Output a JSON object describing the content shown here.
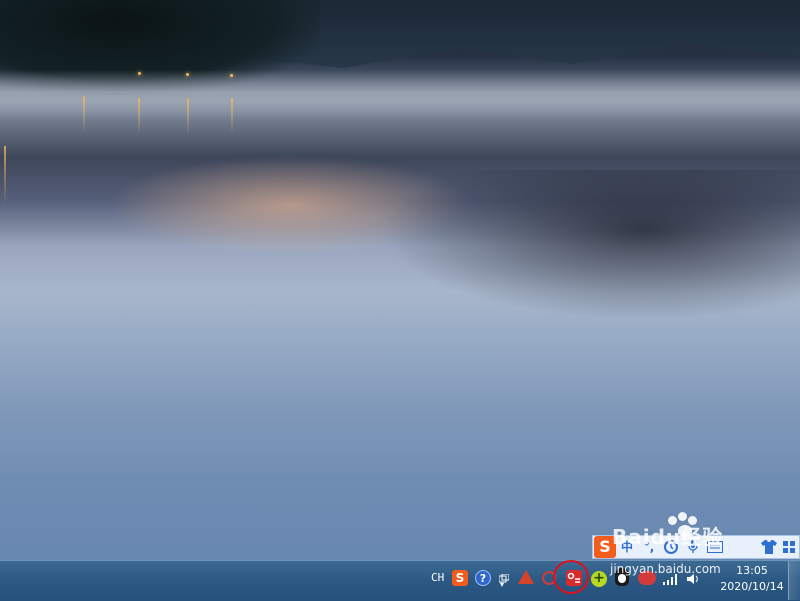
{
  "taskbar": {
    "language_indicator": "CH",
    "clock": {
      "time": "13:05",
      "date": "2020/10/14"
    },
    "tray_icons": [
      "sogou-input-icon",
      "help-icon",
      "network-icon",
      "show-hidden-icons-arrow",
      "red-triangle-app-icon",
      "red-circle-app-icon",
      "red-app-icon",
      "green-plus-app-icon",
      "qq-penguin-icon",
      "red-cloud-app-icon",
      "signal-icon",
      "volume-icon"
    ],
    "highlight_color": "#e0101a"
  },
  "ime_toolbar": {
    "logo": "S",
    "mode": "中",
    "punct": "°,",
    "items": [
      "clock-icon",
      "microphone-icon",
      "keyboard-icon",
      "skin-icon",
      "grid-icon"
    ]
  },
  "watermark": {
    "site": "Baidu经验",
    "url": "jingyan.baidu.com"
  },
  "colors": {
    "taskbar_top": "#3d6a93",
    "taskbar_bottom": "#24507b",
    "sogou_orange": "#f25d1c"
  }
}
